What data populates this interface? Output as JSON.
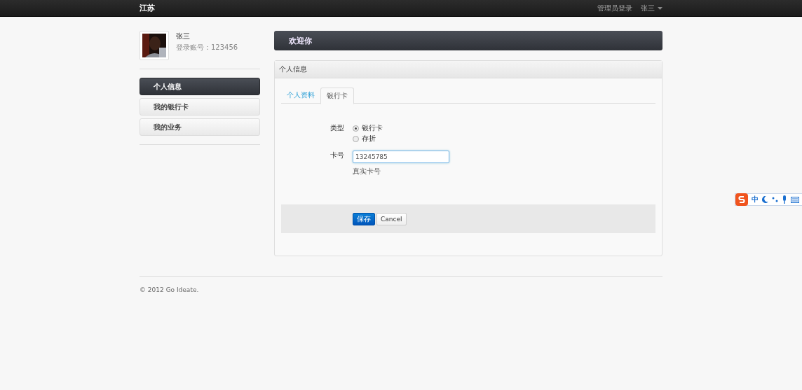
{
  "navbar": {
    "brand": "江苏",
    "links": [
      {
        "label": "管理员登录",
        "kind": "link"
      },
      {
        "label": "张三",
        "kind": "dropdown"
      }
    ]
  },
  "profile": {
    "name": "张三",
    "account": "登录账号：123456"
  },
  "sidebar": {
    "items": [
      {
        "label": "个人信息",
        "selected": true
      },
      {
        "label": "我的银行卡",
        "selected": false
      },
      {
        "label": "我的业务",
        "selected": false
      }
    ]
  },
  "banner": {
    "title": "欢迎你"
  },
  "panel": {
    "title": "个人信息",
    "tabs": [
      {
        "label": "个人资料",
        "selected": false
      },
      {
        "label": "银行卡",
        "selected": true
      }
    ],
    "form": {
      "type_label": "类型",
      "options": [
        {
          "label": "银行卡",
          "selected": true
        },
        {
          "label": "存折",
          "selected": false
        }
      ],
      "card_label": "卡号",
      "card_value": "13245785",
      "card_help": "真实卡号"
    },
    "buttons": [
      {
        "label": "保存",
        "kind": "primary"
      },
      {
        "label": "Cancel",
        "kind": "default"
      }
    ]
  },
  "footer": {
    "text": "© 2012 Go Ideate."
  },
  "ime_toolbar": {
    "mode": "中"
  }
}
